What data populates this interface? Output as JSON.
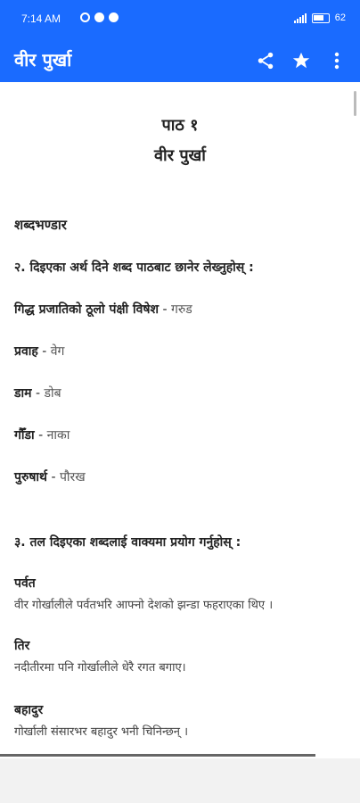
{
  "status_bar": {
    "time": "7:14 AM",
    "battery": "62"
  },
  "app_bar": {
    "title": "वीर पुर्खा",
    "actions": [
      "share-icon",
      "star-icon",
      "more-vert-icon"
    ]
  },
  "lesson": {
    "number": "पाठ १",
    "title": "वीर पुर्खा"
  },
  "vocab": {
    "heading": "शब्दभण्डार",
    "question2": "२. दिइएका अर्थ दिने शब्द पाठबाट छानेर लेख्नुहोस् :",
    "items": [
      {
        "term": "गिद्ध प्रजातिको ठूलो पंक्षी विषेश",
        "sep": " - ",
        "answer": "गरुड"
      },
      {
        "term": "प्रवाह",
        "sep": " - ",
        "answer": "वेग"
      },
      {
        "term": "डाम",
        "sep": " - ",
        "answer": "डोब"
      },
      {
        "term": "गौँडा",
        "sep": " - ",
        "answer": "नाका"
      },
      {
        "term": "पुरुषार्थ",
        "sep": " - ",
        "answer": "पौरख"
      }
    ],
    "question3": "३. तल दिइएका शब्दलाई वाक्यमा प्रयोग गर्नुहोस् :",
    "examples": [
      {
        "word": "पर्वत",
        "sentence": "वीर गोर्खालीले पर्वतभरि आफ्नो देशको झन्डा फहराएका थिए ।"
      },
      {
        "word": "तिर",
        "sentence": "नदीतीरमा पनि गोर्खालीले धेरै रगत बगाए।"
      },
      {
        "word": "बहादुर",
        "sentence": "गोर्खाली संसारभर बहादुर भनी चिनिन्छन् ।"
      }
    ]
  },
  "colors": {
    "accent": "#1a6bff"
  }
}
